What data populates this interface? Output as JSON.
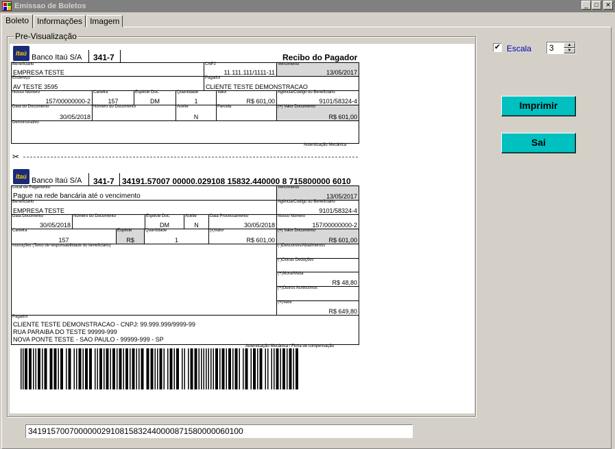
{
  "window": {
    "title": "Emissao de Boletos"
  },
  "tabs": [
    "Boleto",
    "Informações",
    "Imagem"
  ],
  "group": {
    "title": "Pre-Visualização"
  },
  "scale": {
    "label": "Escala",
    "value": "3",
    "checked": true
  },
  "buttons": {
    "print": "Imprimir",
    "exit": "Sai"
  },
  "linha_digitavel_field": "34191570070000002910815832440000871580000060100",
  "bank": {
    "logo_text": "Itaú",
    "name": "Banco Itaú S/A",
    "code": "341-7"
  },
  "recibo": {
    "title": "Recibo do Pagador",
    "beneficiario": {
      "label": "Beneficiário",
      "value": "EMPRESA TESTE"
    },
    "cnpj": {
      "label": "CNPJ",
      "value": "11.111.111/1111-11"
    },
    "vencimento": {
      "label": "Vencimento",
      "value": "13/05/2017"
    },
    "endereco": {
      "label": "Endereço",
      "value": "AV TESTE 3595"
    },
    "pagador": {
      "label": "Pagador",
      "value": "CLIENTE TESTE DEMONSTRACAO"
    },
    "nosso_numero": {
      "label": "Nosso Número",
      "value": "157/00000000-2"
    },
    "carteira": {
      "label": "Carteira",
      "value": "157"
    },
    "especie_doc": {
      "label": "Espécie Doc.",
      "value": "DM"
    },
    "quantidade": {
      "label": "Quantidade",
      "value": "1"
    },
    "valor": {
      "label": "Valor",
      "value": "R$ 601,00"
    },
    "agencia": {
      "label": "Agência/Código do Beneficiário",
      "value": "9101/58324-4"
    },
    "data_documento": {
      "label": "Data do Documento",
      "value": "30/05/2018"
    },
    "numero_documento": {
      "label": "Número do Documento",
      "value": ""
    },
    "aceite": {
      "label": "Aceite",
      "value": "N"
    },
    "parcela": {
      "label": "Parcela",
      "value": ""
    },
    "valor_documento": {
      "label": "(=) Valor Documento",
      "value": "R$ 601,00"
    },
    "demonstrativo": {
      "label": "Demonstrativo"
    },
    "autenticacao": "Autenticação Mecânica"
  },
  "ficha": {
    "linha_digitavel": "34191.57007 00000.029108 15832.440000 8 715800000 6010",
    "local_pagamento": {
      "label": "Local de Pagamento",
      "value": "Pague na rede bancária até o vencimento"
    },
    "vencimento": {
      "label": "Vencimento",
      "value": "13/05/2017"
    },
    "beneficiario": {
      "label": "Beneficiário",
      "value": "EMPRESA TESTE"
    },
    "agencia": {
      "label": "Agência/Código do Beneficiário",
      "value": "9101/58324-4"
    },
    "data_documento": {
      "label": "Data Documento",
      "value": "30/05/2018"
    },
    "numero_documento": {
      "label": "Número do Documento",
      "value": ""
    },
    "especie_doc": {
      "label": "Espécie Doc.",
      "value": "DM"
    },
    "aceite": {
      "label": "Aceite",
      "value": "N"
    },
    "data_processamento": {
      "label": "Data Processamento",
      "value": "30/05/2018"
    },
    "nosso_numero": {
      "label": "Nosso Número",
      "value": "157/00000000-2"
    },
    "carteira": {
      "label": "Carteira",
      "value": "157"
    },
    "especie": {
      "label": "Espécie",
      "value": "R$"
    },
    "quantidade": {
      "label": "Quantidade",
      "value": "1"
    },
    "x_valor": {
      "label": "(x)Valor",
      "value": "R$ 601,00"
    },
    "valor_documento": {
      "label": "(=) Valor Documento",
      "value": "R$ 601,00"
    },
    "instrucoes": {
      "label": "Instruções (Texto de responsabilidade do beneficiário)"
    },
    "descontos": {
      "label": "(-)Descontos/Abatimentos",
      "value": ""
    },
    "outras_deducoes": {
      "label": "(-)Outras Deduções",
      "value": ""
    },
    "mora_multa": {
      "label": "(+)Mora/Multa",
      "value": "R$ 48,80"
    },
    "outros_acrescimos": {
      "label": "(+)Outros Acréscimos",
      "value": ""
    },
    "valor_cobrado": {
      "label": "(=)Valor",
      "value": "R$ 649,80"
    },
    "pagador": {
      "label": "Pagador",
      "line1": "CLIENTE TESTE DEMONSTRACAO - CNPJ: 99.999.999/9999-99",
      "line2": "RUA PARAIBA DO TESTE  99999-999",
      "line3": "NOVA PONTE TESTE - SAO PAULO - 99999-999 - SP"
    },
    "autenticacao": "Autenticação Mecânica / Ficha de compensação"
  }
}
